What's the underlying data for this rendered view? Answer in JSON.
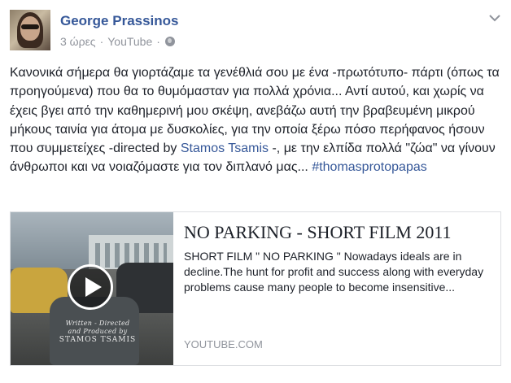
{
  "post": {
    "author": "George Prassinos",
    "time": "3 ώρες",
    "separator": "·",
    "source": "YouTube",
    "text_before_mention": "Κανονικά σήμερα θα γιορτάζαμε τα γενέθλιά σου με ένα -πρωτότυπο- πάρτι (όπως τα προηγούμενα) που θα το θυμόμασταν για πολλά χρόνια... Αντί αυτού, και χωρίς να έχεις βγει από την καθημερινή μου σκέψη, ανεβάζω αυτή την βραβευμένη μικρού μήκους ταινία για άτομα με δυσκολίες, για την οποία ξέρω πόσο περήφανος ήσουν που συμμετείχες -directed by ",
    "mention": "Stamos Tsamis",
    "text_after_mention": " -, με την ελπίδα πολλά \"ζώα\" να γίνουν άνθρωποι και να νοιαζόμαστε για τον διπλανό μας... ",
    "hashtag": "#thomasprotopapas"
  },
  "link_card": {
    "title": "NO PARKING - SHORT FILM 2011",
    "description": "SHORT FILM \" NO PARKING \" Nowadays ideals are in decline.The hunt for profit and success along with everyday problems cause many people to become insensitive...",
    "domain": "YOUTUBE.COM",
    "thumbnail_credits": {
      "line1": "Written - Directed",
      "line2": "and Produced by",
      "line3": "STAMOS TSAMIS"
    }
  },
  "colors": {
    "link": "#365899",
    "text": "#1d2129",
    "meta": "#90949c",
    "border": "#dddfe2"
  },
  "icons": [
    "chevron-down-icon",
    "globe-icon",
    "play-icon"
  ]
}
